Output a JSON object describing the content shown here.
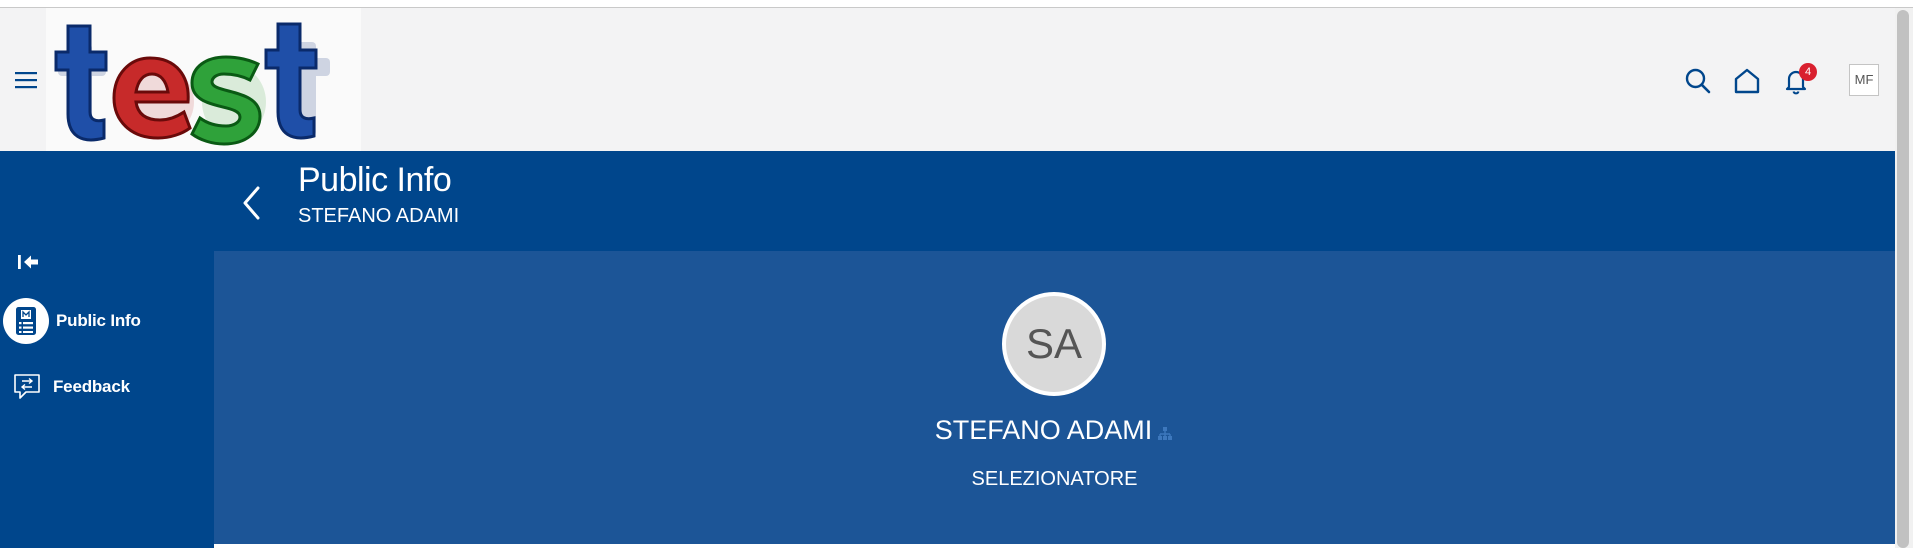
{
  "header": {
    "logo_text": "test",
    "notifications_count": "4",
    "user_initials": "MF"
  },
  "sidebar": {
    "items": [
      {
        "label": "Public Info",
        "icon": "id-badge-icon",
        "active": true
      },
      {
        "label": "Feedback",
        "icon": "feedback-chat-icon",
        "active": false
      }
    ]
  },
  "page": {
    "title": "Public Info",
    "subtitle": "STEFANO ADAMI"
  },
  "profile": {
    "initials": "SA",
    "name": "STEFANO ADAMI",
    "role": "SELEZIONATORE"
  },
  "colors": {
    "primary": "#00468c",
    "hero": "#1c5597",
    "header_bg": "#f3f3f4",
    "badge": "#d9202f"
  }
}
